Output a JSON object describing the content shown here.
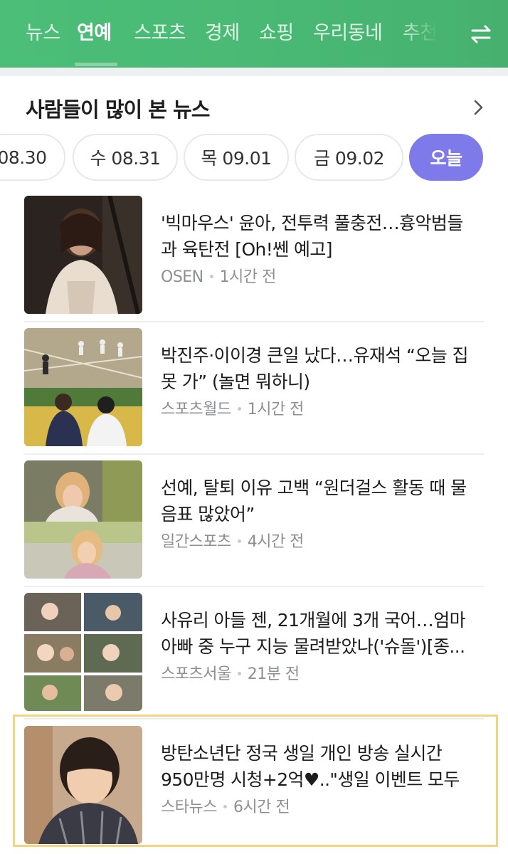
{
  "nav": {
    "tabs": [
      {
        "label": "뉴스"
      },
      {
        "label": "연예"
      },
      {
        "label": "스포츠"
      },
      {
        "label": "경제"
      },
      {
        "label": "쇼핑"
      },
      {
        "label": "우리동네"
      },
      {
        "label": "추천"
      }
    ],
    "active_tab": "연예",
    "swap_icon": "swap-arrows-icon",
    "colors": {
      "bar": "#49b874",
      "active_text": "#ffffff"
    }
  },
  "section": {
    "title": "사람들이 많이 본 뉴스",
    "more_icon": "chevron-right-icon"
  },
  "dates": [
    {
      "label": "08.30"
    },
    {
      "label": "수 08.31"
    },
    {
      "label": "목 09.01"
    },
    {
      "label": "금 09.02"
    },
    {
      "label": "오늘"
    }
  ],
  "active_date": "오늘",
  "accent_color": "#7f7aea",
  "news": [
    {
      "headline": "'빅마우스' 윤아, 전투력 풀충전…흉악범들과 육탄전 [Oh!쎈 예고]",
      "source": "OSEN",
      "time": "1시간 전"
    },
    {
      "headline": "박진주·이이경 큰일 났다…유재석 “오늘 집 못 가” (놀면 뭐하니)",
      "source": "스포츠월드",
      "time": "1시간 전"
    },
    {
      "headline": "선예, 탈퇴 이유 고백 “원더걸스 활동 때 물음표 많았어”",
      "source": "일간스포츠",
      "time": "4시간 전"
    },
    {
      "headline": "사유리 아들 젠, 21개월에 3개 국어…엄마 아빠 중 누구 지능 물려받았나('슈돌')[종...",
      "source": "스포츠서울",
      "time": "21분 전"
    },
    {
      "headline": "방탄소년단 정국 생일 개인 방송 실시간 950만명 시청+2억♥..\"생일 이벤트 모두 ...",
      "source": "스타뉴스",
      "time": "6시간 전"
    }
  ]
}
